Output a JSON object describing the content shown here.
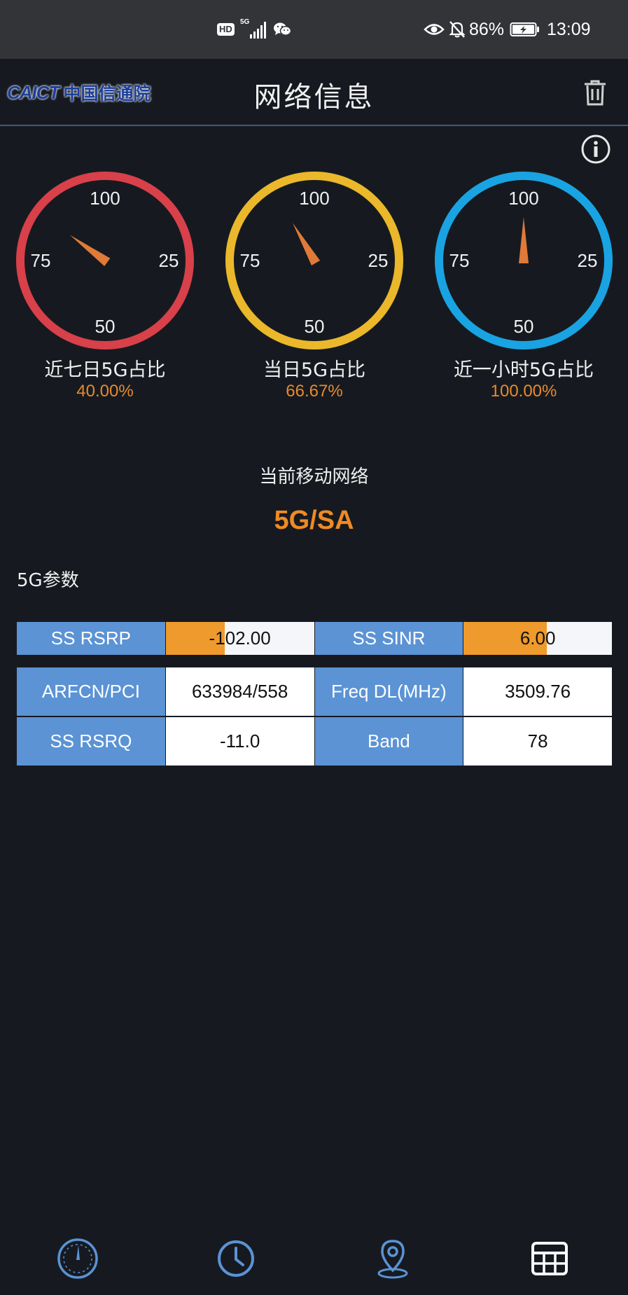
{
  "status_bar": {
    "hd": "HD",
    "signal_5g": "5G",
    "battery_percent": "86%",
    "time": "13:09"
  },
  "header": {
    "logo_en": "CAICT",
    "logo_cn": "中国信通院",
    "title": "网络信息"
  },
  "gauges": [
    {
      "caption": "近七日5G占比",
      "value_text": "40.00%",
      "fraction": 0.4,
      "color": "#d8404a",
      "labels": {
        "top": "100",
        "left": "75",
        "right": "25",
        "bottom": "50"
      }
    },
    {
      "caption": "当日5G占比",
      "value_text": "66.67%",
      "fraction": 0.6667,
      "color": "#eab82a",
      "labels": {
        "top": "100",
        "left": "75",
        "right": "25",
        "bottom": "50"
      }
    },
    {
      "caption": "近一小时5G占比",
      "value_text": "100.00%",
      "fraction": 1.0,
      "color": "#1aa3e2",
      "labels": {
        "top": "100",
        "left": "75",
        "right": "25",
        "bottom": "50"
      }
    }
  ],
  "needle_color": "#e07a38",
  "network": {
    "label": "当前移动网络",
    "value": "5G/SA"
  },
  "params": {
    "section_label": "5G参数",
    "signal_row": {
      "rsrp_label": "SS RSRP",
      "rsrp_value": "-102.00",
      "rsrp_fill_fraction": 0.4,
      "sinr_label": "SS SINR",
      "sinr_value": "6.00",
      "sinr_fill_fraction": 0.56
    },
    "table": [
      {
        "k1": "ARFCN/PCI",
        "v1": "633984/558",
        "k2": "Freq DL(MHz)",
        "v2": "3509.76"
      },
      {
        "k1": "SS RSRQ",
        "v1": "-11.0",
        "k2": "Band",
        "v2": "78"
      }
    ]
  },
  "colors": {
    "background": "#161a20",
    "accent_orange": "#ef8a25",
    "key_blue": "#5b93d5",
    "nav_blue": "#5b93d5"
  },
  "bottom_nav": [
    {
      "icon": "speedometer-icon"
    },
    {
      "icon": "clock-icon"
    },
    {
      "icon": "location-pin-icon"
    },
    {
      "icon": "table-grid-icon"
    }
  ]
}
